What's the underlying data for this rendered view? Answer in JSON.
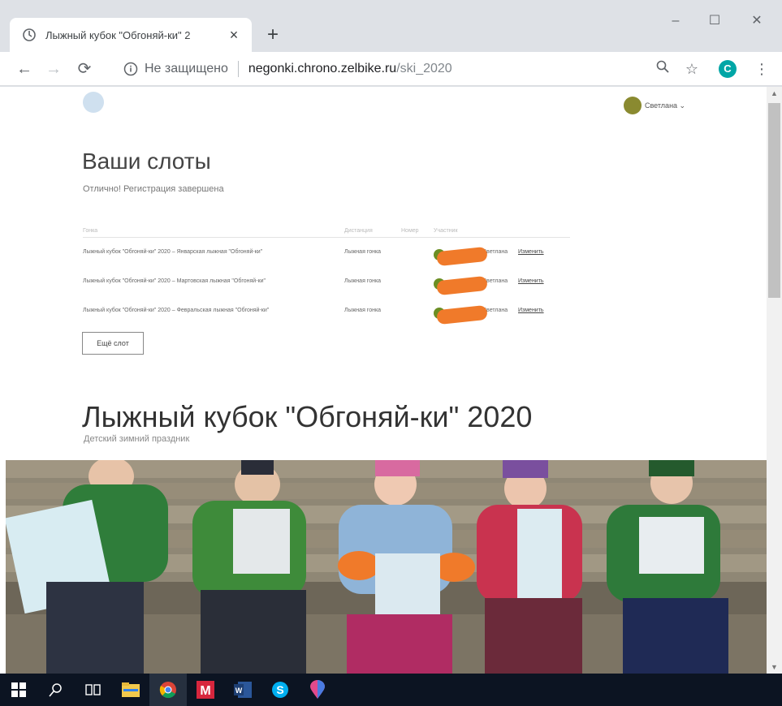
{
  "browser": {
    "tab_title": "Лыжный кубок \"Обгоняй-ки\" 2",
    "security_label": "Не защищено",
    "url_host": "negonki.chrono.zelbike.ru",
    "url_path": "/ski_2020",
    "profile_initial": "C"
  },
  "header": {
    "user_name": "Светлана"
  },
  "slots": {
    "title": "Ваши слоты",
    "message": "Отлично! Регистрация завершена",
    "columns": [
      "Гонка",
      "Дистанция",
      "Номер",
      "Участник"
    ],
    "rows": [
      {
        "race": "Лыжный кубок \"Обгоняй-ки\" 2020 – Январская лыжная \"Обгоняй-ки\"",
        "distance": "Лыжная гонка",
        "participant": "Светлана",
        "action": "Изменить"
      },
      {
        "race": "Лыжный кубок \"Обгоняй-ки\" 2020 – Мартовская лыжная \"Обгоняй-ки\"",
        "distance": "Лыжная гонка",
        "participant": "Светлана",
        "action": "Изменить"
      },
      {
        "race": "Лыжный кубок \"Обгоняй-ки\" 2020 – Февральская лыжная \"Обгоняй-ки\"",
        "distance": "Лыжная гонка",
        "participant": "Светлана",
        "action": "Изменить"
      }
    ],
    "more_button": "Ещё слот"
  },
  "event": {
    "title": "Лыжный кубок \"Обгоняй-ки\" 2020",
    "subtitle": "Детский зимний праздник"
  },
  "taskbar": {
    "items": [
      "start-icon",
      "search-icon",
      "task-view-icon",
      "file-explorer-icon",
      "chrome-icon",
      "mail-icon",
      "word-icon",
      "skype-icon",
      "maps-icon"
    ]
  }
}
